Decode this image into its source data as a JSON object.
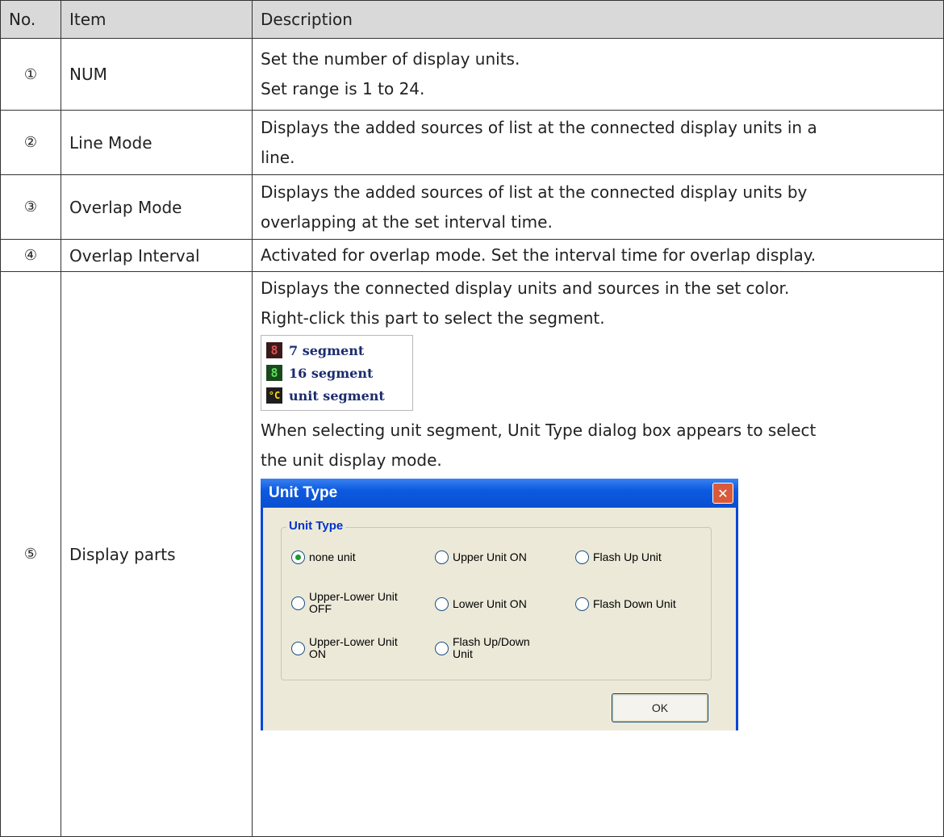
{
  "headers": {
    "no": "No.",
    "item": "Item",
    "description": "Description"
  },
  "rows": [
    {
      "no": "①",
      "item": "NUM",
      "desc": [
        "Set the number of display units.",
        "Set range is 1 to 24."
      ]
    },
    {
      "no": "②",
      "item": "Line Mode",
      "desc": [
        "Displays the added sources of list at the connected display units in a",
        "line."
      ]
    },
    {
      "no": "③",
      "item": "Overlap Mode",
      "desc": [
        "Displays the added sources of list at the connected display units by",
        "overlapping at the set interval time."
      ]
    },
    {
      "no": "④",
      "item": "Overlap Interval",
      "desc": [
        "Activated for overlap mode. Set the interval time for overlap display."
      ]
    },
    {
      "no": "⑤",
      "item": "Display parts",
      "desc": [
        "Displays the connected display units and sources in the set color.",
        "Right-click this part to select the segment.",
        "When selecting unit segment, Unit Type dialog box appears to select",
        "the unit display mode."
      ]
    }
  ],
  "segment_menu": [
    {
      "icon": "seven-segment-icon",
      "glyph": "8",
      "label": "7 segment"
    },
    {
      "icon": "sixteen-segment-icon",
      "glyph": "8",
      "label": "16 segment"
    },
    {
      "icon": "unit-segment-icon",
      "glyph": "°C",
      "label": "unit segment"
    }
  ],
  "dialog": {
    "title": "Unit Type",
    "close": "✕",
    "group_label": "Unit Type",
    "options": [
      {
        "label1": "none unit",
        "label2": "",
        "selected": true
      },
      {
        "label1": "Upper Unit ON",
        "label2": "",
        "selected": false
      },
      {
        "label1": "Flash Up Unit",
        "label2": "",
        "selected": false
      },
      {
        "label1": "Upper-Lower Unit",
        "label2": "OFF",
        "selected": false
      },
      {
        "label1": "Lower Unit ON",
        "label2": "",
        "selected": false
      },
      {
        "label1": "Flash Down Unit",
        "label2": "",
        "selected": false
      },
      {
        "label1": "Upper-Lower Unit",
        "label2": "ON",
        "selected": false
      },
      {
        "label1": "Flash Up/Down",
        "label2": "Unit",
        "selected": false
      }
    ],
    "ok": "OK"
  }
}
